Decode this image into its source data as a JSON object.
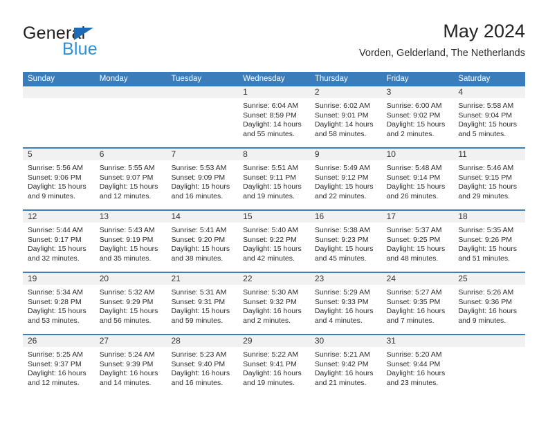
{
  "brand": {
    "name_part1": "General",
    "name_part2": "Blue",
    "triangle_color": "#1b6cb5",
    "blue_color": "#2f8fd4"
  },
  "header": {
    "title": "May 2024",
    "subtitle": "Vorden, Gelderland, The Netherlands"
  },
  "theme": {
    "header_blue": "#3b7cba",
    "day_band_gray": "#f1f1f1",
    "text": "#2a2a2a"
  },
  "weekdays": [
    "Sunday",
    "Monday",
    "Tuesday",
    "Wednesday",
    "Thursday",
    "Friday",
    "Saturday"
  ],
  "weeks": [
    [
      {
        "day": "",
        "empty": true
      },
      {
        "day": "",
        "empty": true
      },
      {
        "day": "",
        "empty": true
      },
      {
        "day": "1",
        "sunrise": "Sunrise: 6:04 AM",
        "sunset": "Sunset: 8:59 PM",
        "daylight": "Daylight: 14 hours and 55 minutes."
      },
      {
        "day": "2",
        "sunrise": "Sunrise: 6:02 AM",
        "sunset": "Sunset: 9:01 PM",
        "daylight": "Daylight: 14 hours and 58 minutes."
      },
      {
        "day": "3",
        "sunrise": "Sunrise: 6:00 AM",
        "sunset": "Sunset: 9:02 PM",
        "daylight": "Daylight: 15 hours and 2 minutes."
      },
      {
        "day": "4",
        "sunrise": "Sunrise: 5:58 AM",
        "sunset": "Sunset: 9:04 PM",
        "daylight": "Daylight: 15 hours and 5 minutes."
      }
    ],
    [
      {
        "day": "5",
        "sunrise": "Sunrise: 5:56 AM",
        "sunset": "Sunset: 9:06 PM",
        "daylight": "Daylight: 15 hours and 9 minutes."
      },
      {
        "day": "6",
        "sunrise": "Sunrise: 5:55 AM",
        "sunset": "Sunset: 9:07 PM",
        "daylight": "Daylight: 15 hours and 12 minutes."
      },
      {
        "day": "7",
        "sunrise": "Sunrise: 5:53 AM",
        "sunset": "Sunset: 9:09 PM",
        "daylight": "Daylight: 15 hours and 16 minutes."
      },
      {
        "day": "8",
        "sunrise": "Sunrise: 5:51 AM",
        "sunset": "Sunset: 9:11 PM",
        "daylight": "Daylight: 15 hours and 19 minutes."
      },
      {
        "day": "9",
        "sunrise": "Sunrise: 5:49 AM",
        "sunset": "Sunset: 9:12 PM",
        "daylight": "Daylight: 15 hours and 22 minutes."
      },
      {
        "day": "10",
        "sunrise": "Sunrise: 5:48 AM",
        "sunset": "Sunset: 9:14 PM",
        "daylight": "Daylight: 15 hours and 26 minutes."
      },
      {
        "day": "11",
        "sunrise": "Sunrise: 5:46 AM",
        "sunset": "Sunset: 9:15 PM",
        "daylight": "Daylight: 15 hours and 29 minutes."
      }
    ],
    [
      {
        "day": "12",
        "sunrise": "Sunrise: 5:44 AM",
        "sunset": "Sunset: 9:17 PM",
        "daylight": "Daylight: 15 hours and 32 minutes."
      },
      {
        "day": "13",
        "sunrise": "Sunrise: 5:43 AM",
        "sunset": "Sunset: 9:19 PM",
        "daylight": "Daylight: 15 hours and 35 minutes."
      },
      {
        "day": "14",
        "sunrise": "Sunrise: 5:41 AM",
        "sunset": "Sunset: 9:20 PM",
        "daylight": "Daylight: 15 hours and 38 minutes."
      },
      {
        "day": "15",
        "sunrise": "Sunrise: 5:40 AM",
        "sunset": "Sunset: 9:22 PM",
        "daylight": "Daylight: 15 hours and 42 minutes."
      },
      {
        "day": "16",
        "sunrise": "Sunrise: 5:38 AM",
        "sunset": "Sunset: 9:23 PM",
        "daylight": "Daylight: 15 hours and 45 minutes."
      },
      {
        "day": "17",
        "sunrise": "Sunrise: 5:37 AM",
        "sunset": "Sunset: 9:25 PM",
        "daylight": "Daylight: 15 hours and 48 minutes."
      },
      {
        "day": "18",
        "sunrise": "Sunrise: 5:35 AM",
        "sunset": "Sunset: 9:26 PM",
        "daylight": "Daylight: 15 hours and 51 minutes."
      }
    ],
    [
      {
        "day": "19",
        "sunrise": "Sunrise: 5:34 AM",
        "sunset": "Sunset: 9:28 PM",
        "daylight": "Daylight: 15 hours and 53 minutes."
      },
      {
        "day": "20",
        "sunrise": "Sunrise: 5:32 AM",
        "sunset": "Sunset: 9:29 PM",
        "daylight": "Daylight: 15 hours and 56 minutes."
      },
      {
        "day": "21",
        "sunrise": "Sunrise: 5:31 AM",
        "sunset": "Sunset: 9:31 PM",
        "daylight": "Daylight: 15 hours and 59 minutes."
      },
      {
        "day": "22",
        "sunrise": "Sunrise: 5:30 AM",
        "sunset": "Sunset: 9:32 PM",
        "daylight": "Daylight: 16 hours and 2 minutes."
      },
      {
        "day": "23",
        "sunrise": "Sunrise: 5:29 AM",
        "sunset": "Sunset: 9:33 PM",
        "daylight": "Daylight: 16 hours and 4 minutes."
      },
      {
        "day": "24",
        "sunrise": "Sunrise: 5:27 AM",
        "sunset": "Sunset: 9:35 PM",
        "daylight": "Daylight: 16 hours and 7 minutes."
      },
      {
        "day": "25",
        "sunrise": "Sunrise: 5:26 AM",
        "sunset": "Sunset: 9:36 PM",
        "daylight": "Daylight: 16 hours and 9 minutes."
      }
    ],
    [
      {
        "day": "26",
        "sunrise": "Sunrise: 5:25 AM",
        "sunset": "Sunset: 9:37 PM",
        "daylight": "Daylight: 16 hours and 12 minutes."
      },
      {
        "day": "27",
        "sunrise": "Sunrise: 5:24 AM",
        "sunset": "Sunset: 9:39 PM",
        "daylight": "Daylight: 16 hours and 14 minutes."
      },
      {
        "day": "28",
        "sunrise": "Sunrise: 5:23 AM",
        "sunset": "Sunset: 9:40 PM",
        "daylight": "Daylight: 16 hours and 16 minutes."
      },
      {
        "day": "29",
        "sunrise": "Sunrise: 5:22 AM",
        "sunset": "Sunset: 9:41 PM",
        "daylight": "Daylight: 16 hours and 19 minutes."
      },
      {
        "day": "30",
        "sunrise": "Sunrise: 5:21 AM",
        "sunset": "Sunset: 9:42 PM",
        "daylight": "Daylight: 16 hours and 21 minutes."
      },
      {
        "day": "31",
        "sunrise": "Sunrise: 5:20 AM",
        "sunset": "Sunset: 9:44 PM",
        "daylight": "Daylight: 16 hours and 23 minutes."
      },
      {
        "day": "",
        "empty": true
      }
    ]
  ]
}
